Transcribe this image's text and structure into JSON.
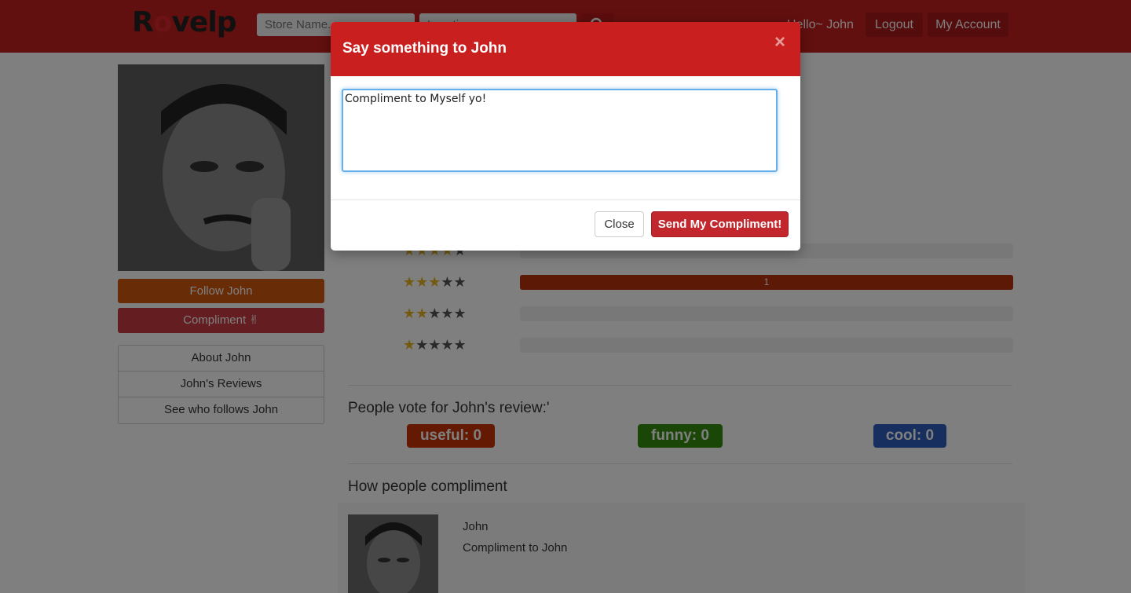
{
  "navbar": {
    "logo": "Rovelp",
    "store_placeholder": "Store Name...",
    "location_placeholder": "Location",
    "greeting": "Hello~ John",
    "logout_label": "Logout",
    "account_label": "My Account"
  },
  "sidebar": {
    "follow_label": "Follow John",
    "compliment_label": "Compliment ✌",
    "menu": [
      {
        "label": "About John"
      },
      {
        "label": "John's Reviews"
      },
      {
        "label": "See who follows John"
      }
    ]
  },
  "ratings": [
    {
      "stars": 4,
      "count": ""
    },
    {
      "stars": 3,
      "count": "1",
      "fill": 1.0
    },
    {
      "stars": 2,
      "count": ""
    },
    {
      "stars": 1,
      "count": ""
    }
  ],
  "votes": {
    "title": "People vote for John's review:'",
    "useful": "useful: 0",
    "funny": "funny: 0",
    "cool": "cool: 0",
    "colors": {
      "useful": "#c93207",
      "funny": "#358c0e",
      "cool": "#2f5fbf"
    }
  },
  "compliments": {
    "title": "How people compliment",
    "items": [
      {
        "author": "John",
        "text": "Compliment to John"
      }
    ]
  },
  "modal": {
    "title": "Say something to John",
    "close_x": "×",
    "textarea_value": "Compliment to Myself yo!",
    "close_label": "Close",
    "send_label": "Send My Compliment!"
  },
  "theme": {
    "brand": "#c41e1e",
    "follow": "#d05a0e",
    "compliment": "#c93d44"
  }
}
